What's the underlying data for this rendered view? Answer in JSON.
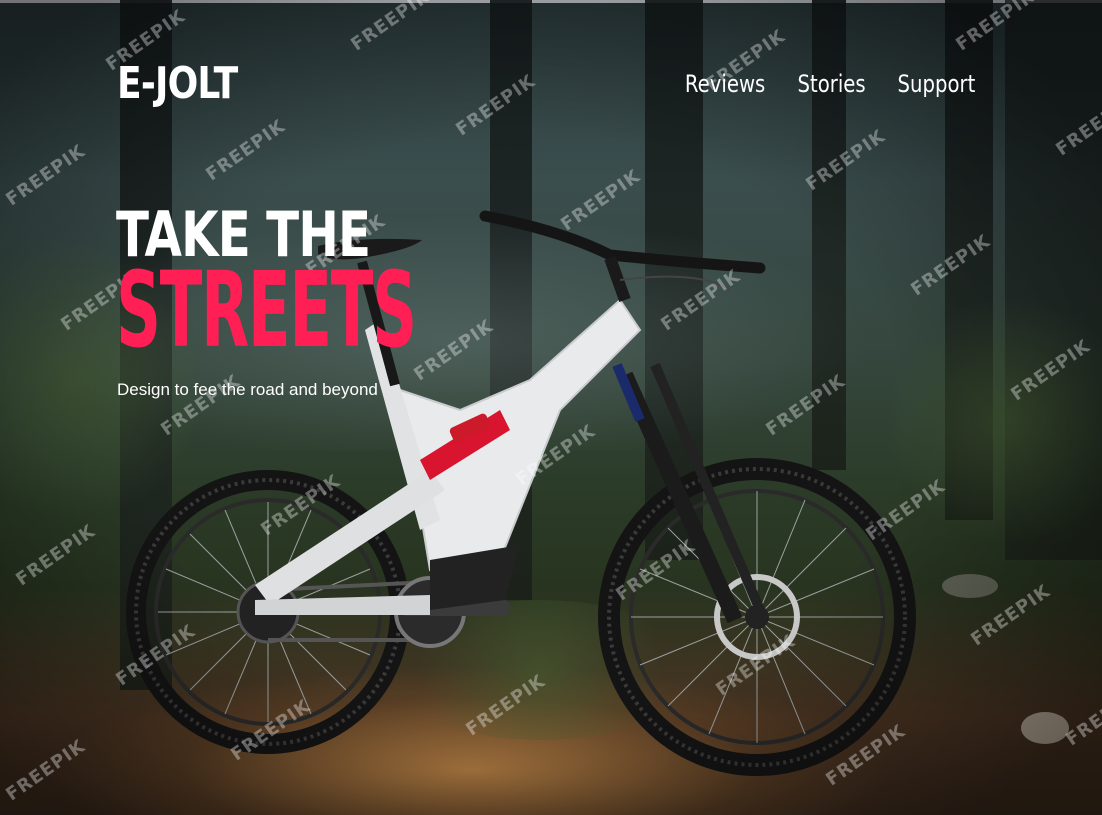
{
  "brand": {
    "logo_text": "E-JOLT"
  },
  "nav": {
    "items": [
      {
        "label": "Reviews"
      },
      {
        "label": "Stories"
      },
      {
        "label": "Support"
      }
    ]
  },
  "hero": {
    "headline_line1": "TAKE THE",
    "headline_line2": "STREETS",
    "tagline": "Design to fee the road and beyond"
  },
  "watermark": {
    "text": "FREEPIK"
  },
  "colors": {
    "accent": "#ff1f55",
    "text": "#ffffff"
  }
}
